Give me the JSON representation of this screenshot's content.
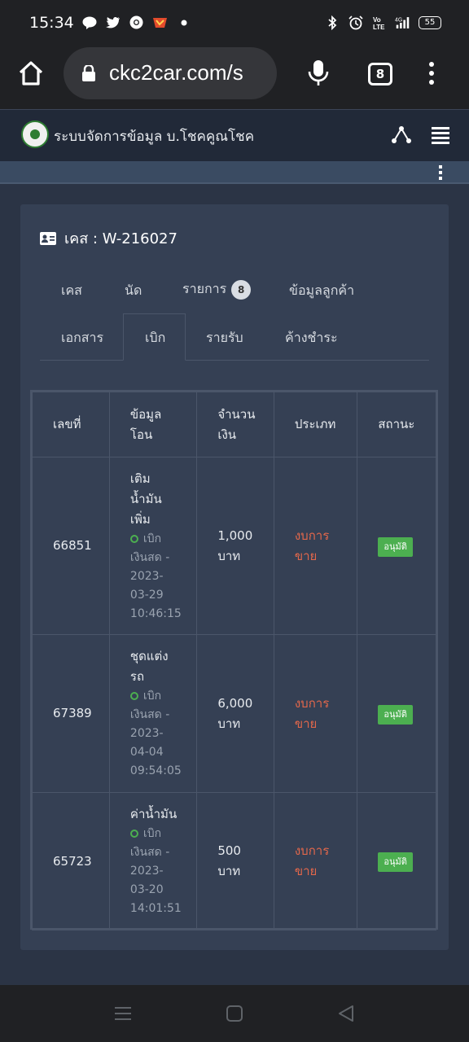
{
  "status_bar": {
    "time": "15:34",
    "left_icons": [
      "line-icon",
      "twitter-icon",
      "chrome-icon",
      "shopee-icon",
      "dot-icon"
    ],
    "right_icons": [
      "bluetooth-icon",
      "alarm-icon",
      "volte-icon",
      "signal-4g-icon"
    ],
    "battery": "55"
  },
  "browser": {
    "url": "ckc2car.com/s",
    "tab_count": "8"
  },
  "app": {
    "title": "ระบบจัดการข้อมูล  บ.โชคคูณโชค"
  },
  "case": {
    "title": "เคส : W-216027"
  },
  "tabs_row1": [
    {
      "label": "เคส"
    },
    {
      "label": "นัด"
    },
    {
      "label": "รายการ",
      "badge": "8"
    },
    {
      "label": "ข้อมูลลูกค้า"
    }
  ],
  "tabs_row2": [
    {
      "label": "เอกสาร"
    },
    {
      "label": "เบิก",
      "active": true
    },
    {
      "label": "รายรับ"
    },
    {
      "label": "ค้างชำระ"
    }
  ],
  "table": {
    "headers": [
      "เลขที่",
      "ข้อมูล\nโอน",
      "จำนวน\nเงิน",
      "ประเภท",
      "สถานะ"
    ],
    "rows": [
      {
        "id": "66851",
        "item": "เติม น้ำมัน เพิ่ม",
        "method": "เบิก เงินสด - 2023- 03-29 10:46:15",
        "amount": "1,000 บาท",
        "type": "งบการ ขาย",
        "status": "อนุมัติ"
      },
      {
        "id": "67389",
        "item": "ชุดแต่ง รถ",
        "method": "เบิก เงินสด - 2023- 04-04 09:54:05",
        "amount": "6,000 บาท",
        "type": "งบการ ขาย",
        "status": "อนุมัติ"
      },
      {
        "id": "65723",
        "item": "ค่าน้ำมัน",
        "method": "เบิก เงินสด - 2023- 03-20 14:01:51",
        "amount": "500 บาท",
        "type": "งบการ ขาย",
        "status": "อนุมัติ"
      }
    ]
  },
  "colors": {
    "accent_green": "#4caf50",
    "type_red": "#e2674b",
    "card_bg": "#354054",
    "page_bg": "#2b3445"
  }
}
